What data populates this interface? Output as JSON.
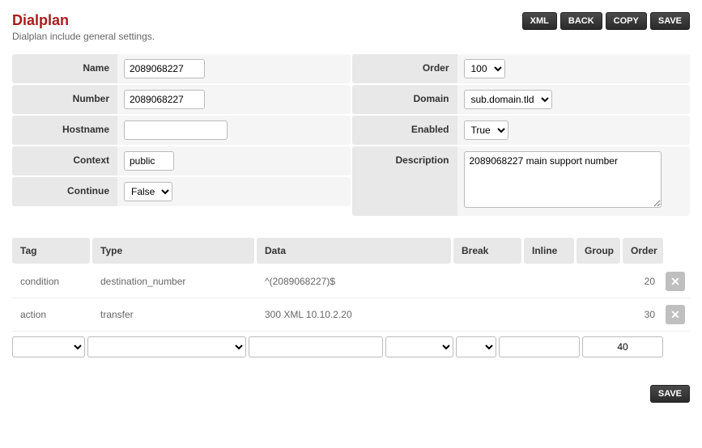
{
  "header": {
    "title": "Dialplan",
    "subtitle": "Dialplan include general settings.",
    "buttons": {
      "xml": "XML",
      "back": "BACK",
      "copy": "COPY",
      "save": "SAVE"
    }
  },
  "form": {
    "left": {
      "name": {
        "label": "Name",
        "value": "2089068227"
      },
      "number": {
        "label": "Number",
        "value": "2089068227"
      },
      "hostname": {
        "label": "Hostname",
        "value": ""
      },
      "context": {
        "label": "Context",
        "value": "public"
      },
      "continue": {
        "label": "Continue",
        "value": "False"
      }
    },
    "right": {
      "order": {
        "label": "Order",
        "value": "100"
      },
      "domain": {
        "label": "Domain",
        "value": "sub.domain.tld"
      },
      "enabled": {
        "label": "Enabled",
        "value": "True"
      },
      "description": {
        "label": "Description",
        "value": "2089068227 main support number"
      }
    }
  },
  "table": {
    "headers": {
      "tag": "Tag",
      "type": "Type",
      "data": "Data",
      "break": "Break",
      "inline": "Inline",
      "group": "Group",
      "order": "Order"
    },
    "rows": [
      {
        "tag": "condition",
        "type": "destination_number",
        "data": "^(2089068227)$",
        "break": "",
        "inline": "",
        "group": "",
        "order": "20"
      },
      {
        "tag": "action",
        "type": "transfer",
        "data": "300 XML 10.10.2.20",
        "break": "",
        "inline": "",
        "group": "",
        "order": "30"
      }
    ],
    "new_row": {
      "tag": "",
      "type": "",
      "data": "",
      "break": "",
      "inline": "",
      "group": "",
      "order": "40"
    }
  },
  "footer": {
    "save": "SAVE"
  }
}
